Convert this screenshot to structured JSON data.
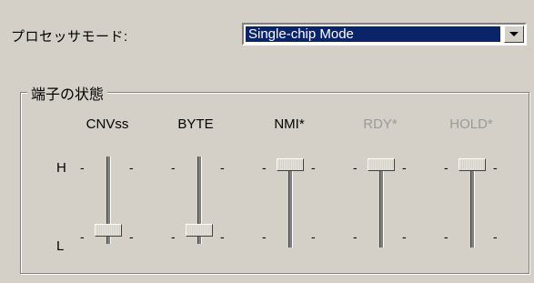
{
  "processor_mode": {
    "label": "プロセッサモード:",
    "selected": "Single-chip Mode"
  },
  "pin_state": {
    "title": "端子の状態",
    "high_label": "H",
    "low_label": "L",
    "pins": [
      {
        "label": "CNVss",
        "state": "L",
        "enabled": true
      },
      {
        "label": "BYTE",
        "state": "L",
        "enabled": true
      },
      {
        "label": "NMI*",
        "state": "H",
        "enabled": true
      },
      {
        "label": "RDY*",
        "state": "H",
        "enabled": false
      },
      {
        "label": "HOLD*",
        "state": "H",
        "enabled": false
      }
    ]
  },
  "icons": {
    "dropdown": "chevron-down-icon"
  }
}
